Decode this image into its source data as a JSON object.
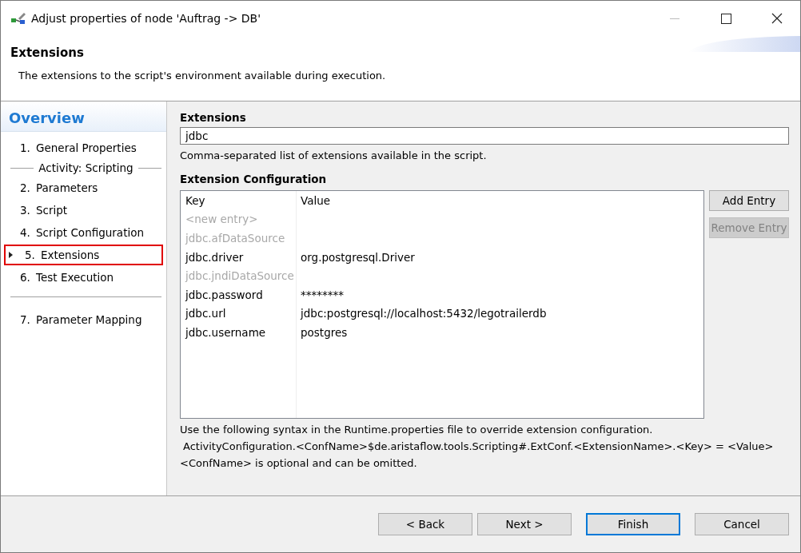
{
  "window": {
    "title": "Adjust properties of node 'Auftrag -> DB'"
  },
  "header": {
    "title": "Extensions",
    "description": "The extensions to the script's environment available during execution."
  },
  "sidebar": {
    "title": "Overview",
    "items": [
      {
        "kind": "item",
        "number": "1.",
        "label": "General Properties",
        "selected": false
      },
      {
        "kind": "group",
        "label": "Activity: Scripting"
      },
      {
        "kind": "item",
        "number": "2.",
        "label": "Parameters",
        "selected": false
      },
      {
        "kind": "item",
        "number": "3.",
        "label": "Script",
        "selected": false
      },
      {
        "kind": "item",
        "number": "4.",
        "label": "Script Configuration",
        "selected": false
      },
      {
        "kind": "item",
        "number": "5.",
        "label": "Extensions",
        "selected": true
      },
      {
        "kind": "item",
        "number": "6.",
        "label": "Test Execution",
        "selected": false
      },
      {
        "kind": "rule"
      },
      {
        "kind": "item",
        "number": "7.",
        "label": "Parameter Mapping",
        "selected": false
      }
    ]
  },
  "extensions": {
    "label": "Extensions",
    "value": "jdbc",
    "hint": "Comma-separated list of extensions available in the script."
  },
  "configuration": {
    "label": "Extension Configuration",
    "columns": [
      "Key",
      "Value"
    ],
    "rows": [
      {
        "key": "<new entry>",
        "disabled": true
      },
      {
        "key": "jdbc.afDataSource",
        "disabled": true
      },
      {
        "key": "jdbc.driver",
        "value": "org.postgresql.Driver",
        "disabled": false
      },
      {
        "key": "jdbc.jndiDataSource",
        "disabled": true
      },
      {
        "key": "jdbc.password",
        "value": "********",
        "disabled": false
      },
      {
        "key": "jdbc.url",
        "value": "jdbc:postgresql://localhost:5432/legotrailerdb",
        "disabled": false
      },
      {
        "key": "jdbc.username",
        "value": "postgres",
        "disabled": false
      }
    ],
    "buttons": [
      {
        "label": "Add Entry",
        "disabled": false
      },
      {
        "label": "Remove Entry",
        "disabled": true
      }
    ]
  },
  "notes": [
    "Use the following syntax in the Runtime.properties file to override extension configuration.",
    "ActivityConfiguration.<ConfName>$de.aristaflow.tools.Scripting#.ExtConf.<ExtensionName>.<Key> = <Value>",
    "<ConfName> is optional and can be omitted."
  ],
  "footer": {
    "buttons": [
      {
        "label": "< Back",
        "default": false
      },
      {
        "label": "Next >",
        "default": false
      },
      {
        "label": "Finish",
        "default": true
      },
      {
        "label": "Cancel",
        "default": false
      }
    ]
  }
}
